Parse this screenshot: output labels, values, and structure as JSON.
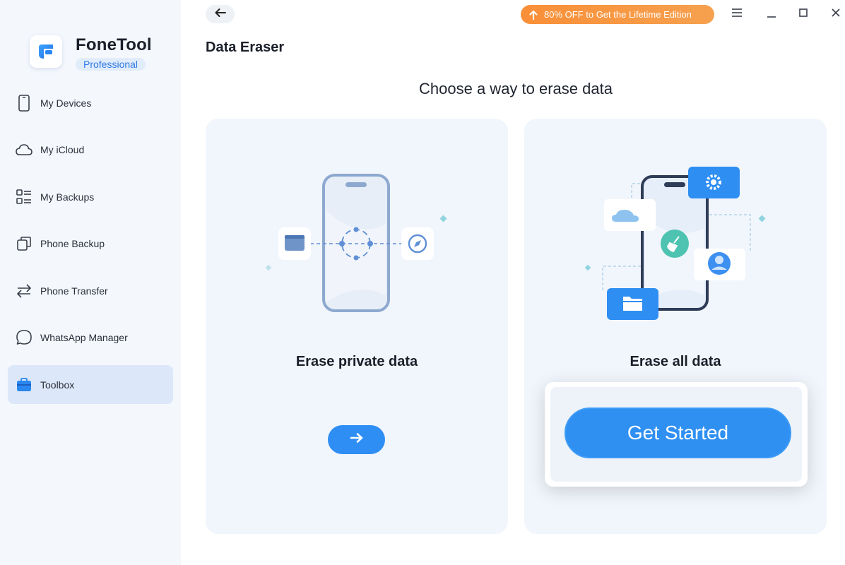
{
  "app": {
    "name": "FoneTool",
    "edition": "Professional"
  },
  "sidebar": {
    "items": [
      {
        "label": "My Devices",
        "icon": "phone-icon"
      },
      {
        "label": "My iCloud",
        "icon": "cloud-icon"
      },
      {
        "label": "My Backups",
        "icon": "backups-list-icon"
      },
      {
        "label": "Phone Backup",
        "icon": "copy-icon"
      },
      {
        "label": "Phone Transfer",
        "icon": "transfer-arrows-icon"
      },
      {
        "label": "WhatsApp Manager",
        "icon": "chat-bubble-icon"
      },
      {
        "label": "Toolbox",
        "icon": "toolbox-icon",
        "active": true
      }
    ]
  },
  "header": {
    "promo_label": "80% OFF to Get the Lifetime Edition",
    "page_title": "Data Eraser"
  },
  "main": {
    "subtitle": "Choose a way to erase data",
    "cards": [
      {
        "title": "Erase private data"
      },
      {
        "title": "Erase all data"
      }
    ],
    "get_started_label": "Get Started"
  },
  "colors": {
    "accent": "#2e8ef3",
    "promo": "#f98f38",
    "sidebar_bg": "#f4f7fc",
    "card_bg": "#f1f5fc",
    "active_bg": "#dce8f9"
  }
}
